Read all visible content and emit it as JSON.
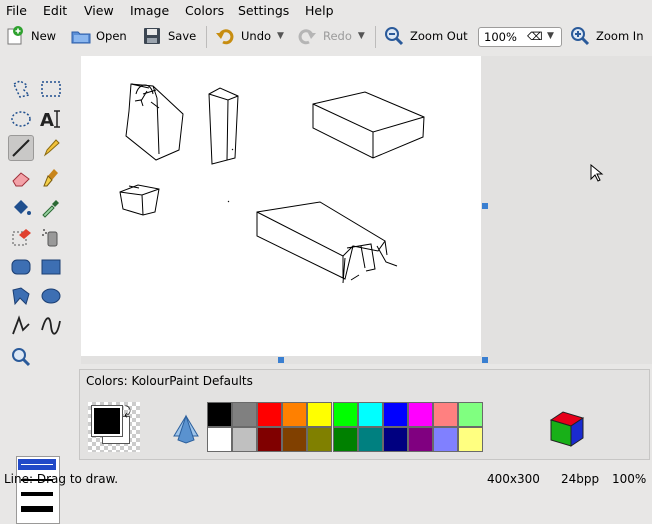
{
  "menu": [
    "File",
    "Edit",
    "View",
    "Image",
    "Colors",
    "Settings",
    "Help"
  ],
  "toolbar": {
    "new_label": "New",
    "open_label": "Open",
    "save_label": "Save",
    "undo_label": "Undo",
    "redo_label": "Redo",
    "zoom_out_label": "Zoom Out",
    "zoom_value": "100%",
    "zoom_in_label": "Zoom In"
  },
  "tools": [
    "free-form-select",
    "rectangular-select",
    "elliptical-select",
    "text",
    "line",
    "pen",
    "eraser",
    "brush",
    "flood-fill",
    "color-picker",
    "color-eraser",
    "spraycan",
    "rounded-rectangle",
    "rectangle",
    "polygon",
    "ellipse",
    "connected-lines",
    "curve",
    "zoom"
  ],
  "palette": {
    "title": "Colors: KolourPaint Defaults",
    "foreground": "#000000",
    "background": "#ffffff",
    "row1": [
      "#000000",
      "#808080",
      "#ff0000",
      "#ff8000",
      "#ffff00",
      "#00ff00",
      "#00ffff",
      "#0000ff",
      "#ff00ff",
      "#ff8080",
      "#80ff80"
    ],
    "row2": [
      "#ffffff",
      "#c0c0c0",
      "#800000",
      "#804000",
      "#808000",
      "#008000",
      "#008080",
      "#000080",
      "#800080",
      "#8080ff",
      "#ffff80"
    ]
  },
  "status": {
    "hint": "Line: Drag to draw.",
    "size": "400x300",
    "depth": "24bpp",
    "zoom": "100%"
  }
}
